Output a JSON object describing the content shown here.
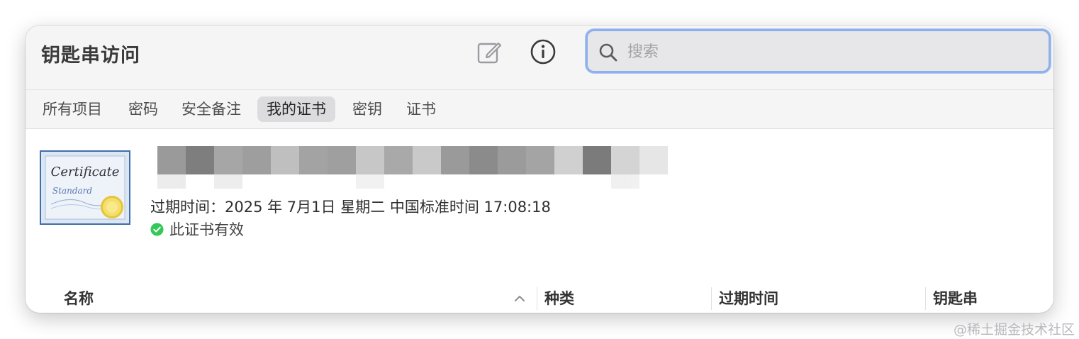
{
  "window": {
    "title": "钥匙串访问",
    "toolbar": {
      "compose_icon": "compose-icon",
      "info_icon": "info-icon",
      "search_placeholder": "搜索",
      "search_value": ""
    },
    "tabs": [
      {
        "label": "所有项目",
        "active": false
      },
      {
        "label": "密码",
        "active": false
      },
      {
        "label": "安全备注",
        "active": false
      },
      {
        "label": "我的证书",
        "active": true
      },
      {
        "label": "密钥",
        "active": false
      },
      {
        "label": "证书",
        "active": false
      }
    ],
    "certificate": {
      "icon_text_1": "Certificate",
      "icon_text_2": "Standard",
      "expiry": "过期时间：2025 年 7月1日 星期二 中国标准时间 17:08:18",
      "status": "此证书有效",
      "status_color": "#34c759"
    },
    "table": {
      "columns": [
        "名称",
        "种类",
        "过期时间",
        "钥匙串"
      ],
      "sorted_column": "名称",
      "sort_direction": "ascending"
    }
  },
  "watermark": "@稀土掘金技术社区"
}
